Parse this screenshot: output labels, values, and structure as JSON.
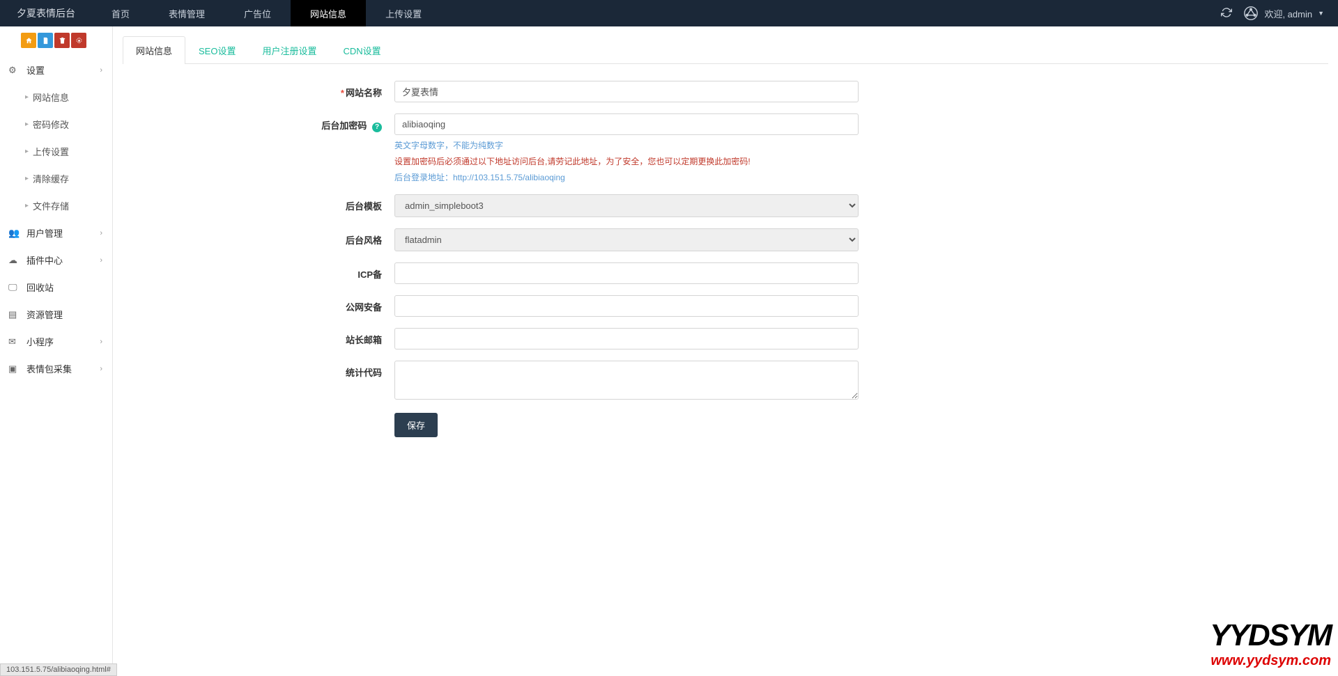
{
  "brand": "夕夏表情后台",
  "topnav": {
    "items": [
      "首页",
      "表情管理",
      "广告位",
      "网站信息",
      "上传设置"
    ],
    "activeIndex": 3
  },
  "userArea": {
    "welcome": "欢迎, admin"
  },
  "sidebar": {
    "settings": {
      "label": "设置",
      "children": [
        "网站信息",
        "密码修改",
        "上传设置",
        "清除缓存",
        "文件存储"
      ]
    },
    "items": [
      {
        "label": "用户管理",
        "hasChildren": true
      },
      {
        "label": "插件中心",
        "hasChildren": true
      },
      {
        "label": "回收站",
        "hasChildren": false
      },
      {
        "label": "资源管理",
        "hasChildren": false
      },
      {
        "label": "小程序",
        "hasChildren": true
      },
      {
        "label": "表情包采集",
        "hasChildren": true
      }
    ]
  },
  "tabs": {
    "items": [
      "网站信息",
      "SEO设置",
      "用户注册设置",
      "CDN设置"
    ],
    "activeIndex": 0
  },
  "form": {
    "siteName": {
      "label": "网站名称",
      "value": "夕夏表情",
      "required": true
    },
    "adminCode": {
      "label": "后台加密码",
      "value": "alibiaoqing",
      "hint1": "英文字母数字，不能为纯数字",
      "hint2": "设置加密码后必须通过以下地址访问后台,请劳记此地址，为了安全，您也可以定期更换此加密码!",
      "hint3": "后台登录地址：http://103.151.5.75/alibiaoqing"
    },
    "adminTemplate": {
      "label": "后台模板",
      "value": "admin_simpleboot3"
    },
    "adminStyle": {
      "label": "后台风格",
      "value": "flatadmin"
    },
    "icp": {
      "label": "ICP备",
      "value": ""
    },
    "police": {
      "label": "公网安备",
      "value": ""
    },
    "email": {
      "label": "站长邮箱",
      "value": ""
    },
    "stats": {
      "label": "统计代码",
      "value": ""
    },
    "saveBtn": "保存"
  },
  "statusbar": "103.151.5.75/alibiaoqing.html#",
  "watermark": {
    "l1": "YYDSYM",
    "l2": "www.yydsym.com"
  }
}
